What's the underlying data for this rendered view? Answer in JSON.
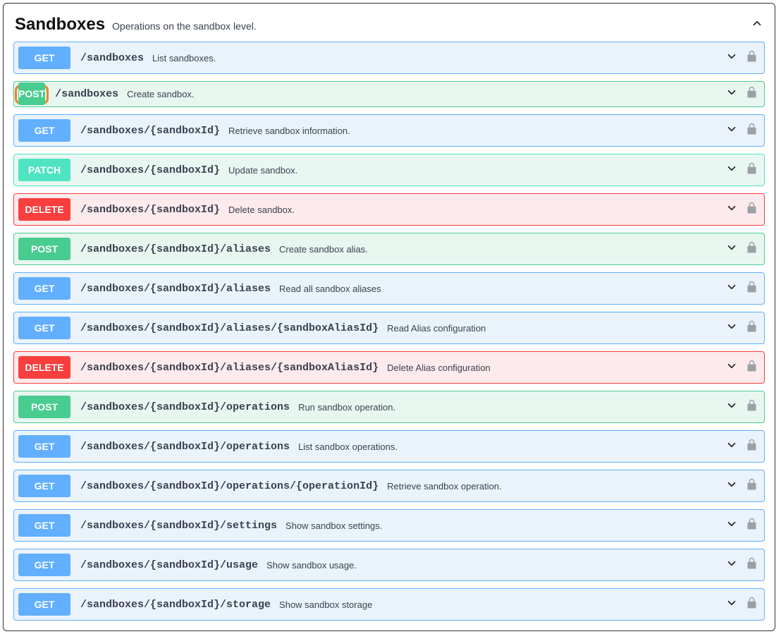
{
  "section": {
    "title": "Sandboxes",
    "description": "Operations on the sandbox level."
  },
  "operations": [
    {
      "method": "GET",
      "path": "/sandboxes",
      "summary": "List sandboxes.",
      "highlighted": false
    },
    {
      "method": "POST",
      "path": "/sandboxes",
      "summary": "Create sandbox.",
      "highlighted": true
    },
    {
      "method": "GET",
      "path": "/sandboxes/{sandboxId}",
      "summary": "Retrieve sandbox information.",
      "highlighted": false
    },
    {
      "method": "PATCH",
      "path": "/sandboxes/{sandboxId}",
      "summary": "Update sandbox.",
      "highlighted": false
    },
    {
      "method": "DELETE",
      "path": "/sandboxes/{sandboxId}",
      "summary": "Delete sandbox.",
      "highlighted": false
    },
    {
      "method": "POST",
      "path": "/sandboxes/{sandboxId}/aliases",
      "summary": "Create sandbox alias.",
      "highlighted": false
    },
    {
      "method": "GET",
      "path": "/sandboxes/{sandboxId}/aliases",
      "summary": "Read all sandbox aliases",
      "highlighted": false
    },
    {
      "method": "GET",
      "path": "/sandboxes/{sandboxId}/aliases/{sandboxAliasId}",
      "summary": "Read Alias configuration",
      "highlighted": false
    },
    {
      "method": "DELETE",
      "path": "/sandboxes/{sandboxId}/aliases/{sandboxAliasId}",
      "summary": "Delete Alias configuration",
      "highlighted": false
    },
    {
      "method": "POST",
      "path": "/sandboxes/{sandboxId}/operations",
      "summary": "Run sandbox operation.",
      "highlighted": false
    },
    {
      "method": "GET",
      "path": "/sandboxes/{sandboxId}/operations",
      "summary": "List sandbox operations.",
      "highlighted": false
    },
    {
      "method": "GET",
      "path": "/sandboxes/{sandboxId}/operations/{operationId}",
      "summary": "Retrieve sandbox operation.",
      "highlighted": false
    },
    {
      "method": "GET",
      "path": "/sandboxes/{sandboxId}/settings",
      "summary": "Show sandbox settings.",
      "highlighted": false
    },
    {
      "method": "GET",
      "path": "/sandboxes/{sandboxId}/usage",
      "summary": "Show sandbox usage.",
      "highlighted": false
    },
    {
      "method": "GET",
      "path": "/sandboxes/{sandboxId}/storage",
      "summary": "Show sandbox storage",
      "highlighted": false
    }
  ]
}
